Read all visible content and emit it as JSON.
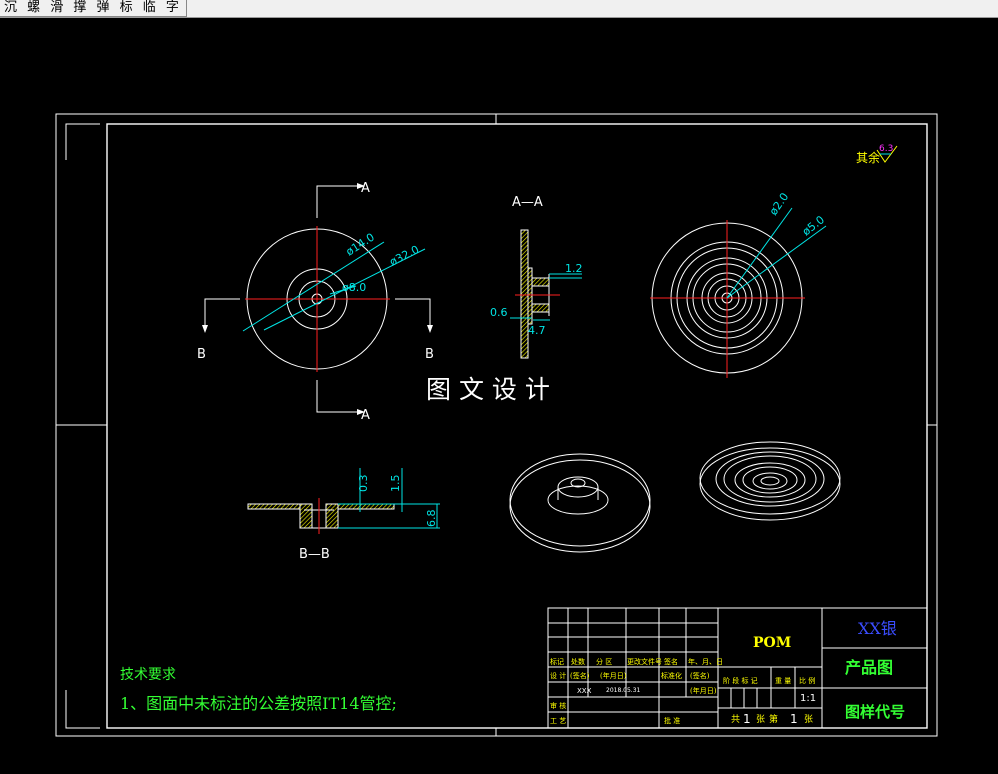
{
  "window_title": "沉 螺 滑 撑 弹 标 临 字",
  "colors": {
    "background": "#000000",
    "line": "#ffffff",
    "center_line": "#ff2020",
    "dimension": "#00e5e5",
    "section_line": "#ffff00",
    "note_text": "#33ff33",
    "title_block_text": "#ffff00",
    "title_block_big": "#33ff33",
    "company": "#3b4dff"
  },
  "surface_finish": {
    "label": "其余",
    "value": "6.3"
  },
  "views": {
    "front": {
      "section_a": "A",
      "section_b": "B",
      "dims": [
        "ø14.0",
        "ø32.0",
        "ø8.0"
      ]
    },
    "section_aa": {
      "title": "A—A",
      "dims": [
        "1.2",
        "0.6",
        "4.7"
      ]
    },
    "right": {
      "dims": [
        "ø2.0",
        "ø5.0"
      ]
    },
    "section_bb": {
      "title": "B—B",
      "dims": [
        "0.3",
        "1.5",
        "6.8"
      ]
    }
  },
  "watermark": "图 文 设 计",
  "tech_requirements": {
    "heading": "技术要求",
    "items": [
      "1、图面中未标注的公差按照IT14管控;"
    ]
  },
  "title_block": {
    "row_labels_top": [
      "标记",
      "处数",
      "分  区",
      "更改文件号",
      "签名",
      "年、月、日"
    ],
    "designer_row": [
      "设 计",
      "(签名)",
      "(年月日)",
      "标准化",
      "(签名)",
      "(年月日)"
    ],
    "designer": "XXX",
    "date": "2018.05.31",
    "review": "审 核",
    "process": "工 艺",
    "approve": "批 准",
    "stage_labels": [
      "阶 段 标 记",
      "重 量",
      "比 例"
    ],
    "scale": "1:1",
    "sheets": [
      "共",
      "1",
      "张",
      "第",
      "1",
      "张"
    ],
    "material": "POM",
    "company": "XX银",
    "product": "产品图",
    "drawing_no": "图样代号"
  }
}
